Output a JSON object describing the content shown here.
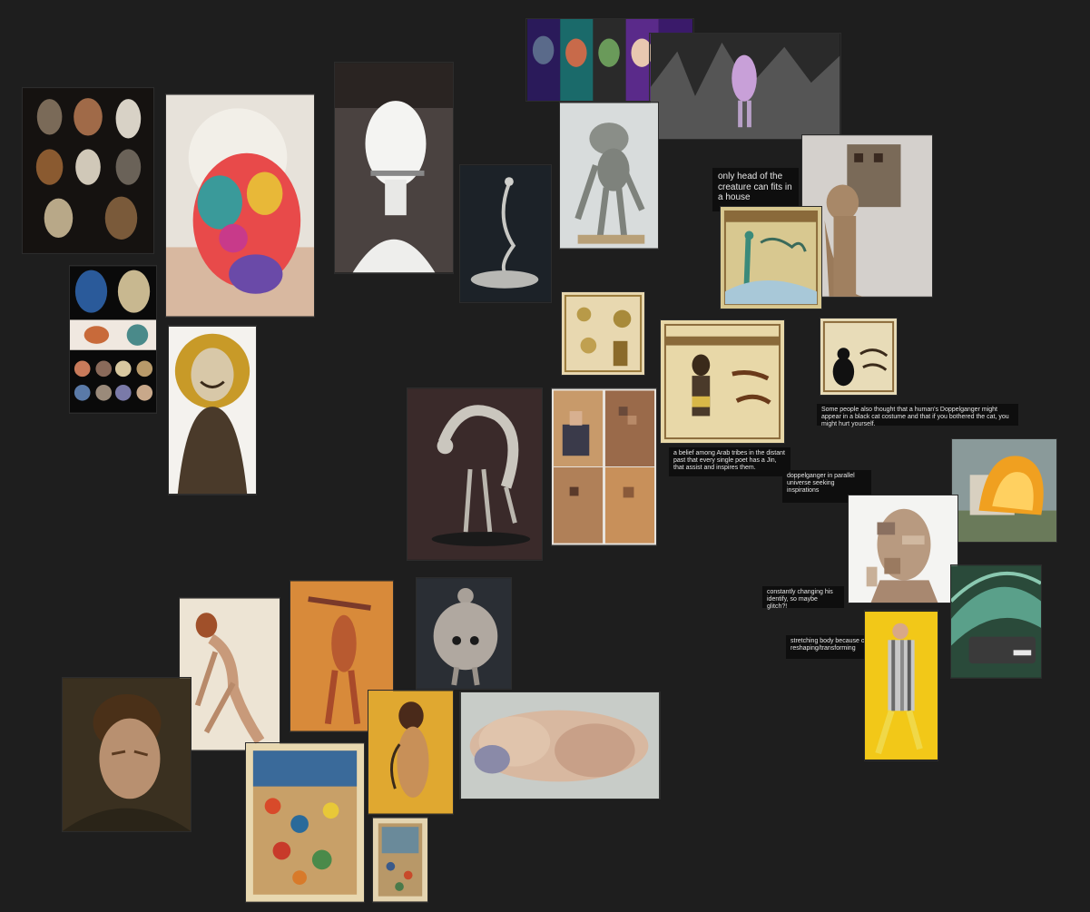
{
  "board": {
    "background": "#1e1e1e",
    "notes": {
      "house": "only head of the creature can fits in a house",
      "doppel_cat": "Some people also thought that a human's Doppelganger might appear in a black cat costume and that if you bothered the cat, you might hurt yourself.",
      "jin": "a belief among Arab tribes in the distant past that every single poet has a Jin, that assist and inspires them.",
      "parallel": "doppelganger in parallel universe seeking inspirations",
      "glitch": "constantly changing his identify, so maybe glitch?!",
      "stretch": "stretching body because of reshaping/transforming"
    },
    "images": [
      {
        "name": "tribal-masks-collage",
        "icon": "mask-image"
      },
      {
        "name": "knitted-mask-head",
        "icon": "sculpture-image"
      },
      {
        "name": "white-mannequin-head",
        "icon": "sculpture-image"
      },
      {
        "name": "stretched-neck-figure",
        "icon": "sculpture-image"
      },
      {
        "name": "puppet-faces-strip",
        "icon": "puppet-image"
      },
      {
        "name": "dark-forest-figure",
        "icon": "photo-image"
      },
      {
        "name": "clay-creature",
        "icon": "sculpture-image"
      },
      {
        "name": "house-headed-sculpture",
        "icon": "sculpture-image"
      },
      {
        "name": "doppelganger-illustration",
        "icon": "poster-image"
      },
      {
        "name": "carved-masks-grid",
        "icon": "mask-image"
      },
      {
        "name": "sun-mask-figure",
        "icon": "sculpture-image"
      },
      {
        "name": "jin-card-small",
        "icon": "poster-image"
      },
      {
        "name": "tabi-tabia-card",
        "icon": "poster-image"
      },
      {
        "name": "black-cat-card",
        "icon": "poster-image"
      },
      {
        "name": "arched-creature-sculpture",
        "icon": "sculpture-image"
      },
      {
        "name": "pixel-sculpture-grid",
        "icon": "sculpture-image"
      },
      {
        "name": "burning-house",
        "icon": "photo-image"
      },
      {
        "name": "glitched-bust",
        "icon": "sculpture-image"
      },
      {
        "name": "stretched-car",
        "icon": "photo-image"
      },
      {
        "name": "yellow-stretched-figure",
        "icon": "photo-image"
      },
      {
        "name": "schiele-figure-bent",
        "icon": "painting-image"
      },
      {
        "name": "schiele-figure-orange",
        "icon": "painting-image"
      },
      {
        "name": "bloated-figure-sculpture",
        "icon": "sculpture-image"
      },
      {
        "name": "freud-portrait",
        "icon": "painting-image"
      },
      {
        "name": "schiele-self-portrait",
        "icon": "painting-image"
      },
      {
        "name": "reclining-flesh-painting",
        "icon": "painting-image"
      },
      {
        "name": "persian-miniature-battle",
        "icon": "painting-image"
      },
      {
        "name": "persian-miniature-small",
        "icon": "painting-image"
      }
    ]
  }
}
